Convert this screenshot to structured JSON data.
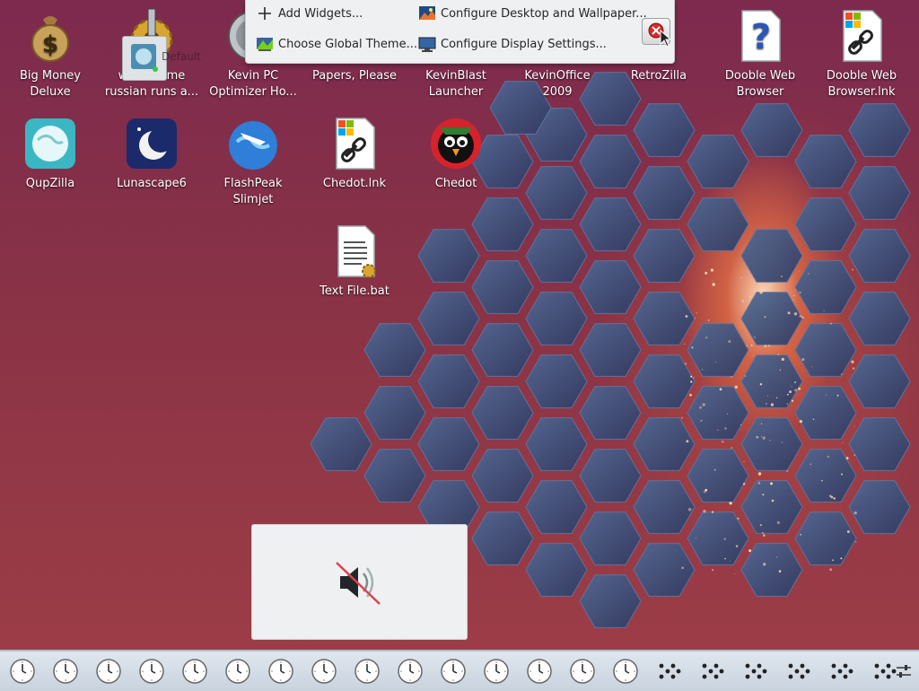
{
  "desktop": {
    "icons_row1": [
      {
        "label": "Big Money Deluxe",
        "icon": "money-bag-icon"
      },
      {
        "label": "when some russian runs a...",
        "icon": "gear-icon"
      },
      {
        "label": "Kevin PC Optimizer Ho...",
        "icon": "optimizer-icon"
      },
      {
        "label": "Papers, Please",
        "icon": "document-icon"
      },
      {
        "label": "KevinBlast Launcher",
        "icon": "launcher-icon"
      },
      {
        "label": "KevinOffice 2009",
        "icon": "office-icon"
      },
      {
        "label": "RetroZilla",
        "icon": "retrozilla-icon"
      },
      {
        "label": "Dooble Web Browser",
        "icon": "question-file-icon"
      },
      {
        "label": "Dooble Web Browser.lnk",
        "icon": "shortcut-file-icon"
      }
    ],
    "icons_row2": [
      {
        "label": "QupZilla",
        "icon": "globe-icon"
      },
      {
        "label": "Lunascape6",
        "icon": "moon-icon"
      },
      {
        "label": "FlashPeak Slimjet",
        "icon": "earth-plane-icon"
      },
      {
        "label": "Chedot.lnk",
        "icon": "shortcut-file-icon"
      },
      {
        "label": "Chedot",
        "icon": "bird-icon"
      }
    ],
    "icons_row3": [
      {
        "label": "Text File.bat",
        "icon": "batch-file-icon"
      }
    ],
    "ghost_label": "Default"
  },
  "context_toolbar": {
    "add_widgets": "Add Widgets...",
    "choose_global_theme": "Choose Global Theme...",
    "configure_desktop": "Configure Desktop and Wallpaper...",
    "configure_display": "Configure Display Settings..."
  },
  "osd": {
    "icon": "speaker-muted-icon",
    "state": "muted"
  },
  "panel": {
    "clock_count": 15,
    "dots_count": 6,
    "items": [
      "analog-clock-icon",
      "dots-applet-icon",
      "panel-settings-icon"
    ]
  },
  "colors": {
    "toolbar_bg": "#eff0f1",
    "panel_bg": "#d5dde7",
    "wallpaper": "#8a3346"
  }
}
